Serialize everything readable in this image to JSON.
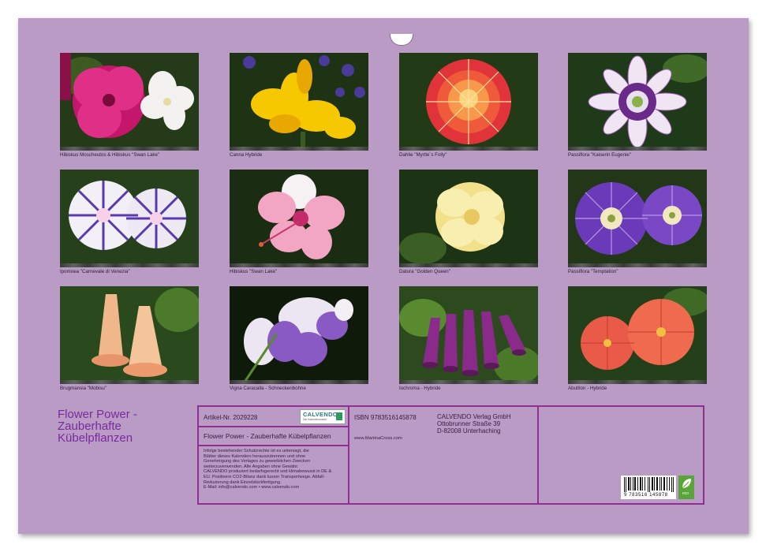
{
  "photos": [
    {
      "caption": "Hibiskus Moscheutos & Hibiskus \"Swan Lake\""
    },
    {
      "caption": "Canna Hybride"
    },
    {
      "caption": "Dahlie \"Myrtle´s Folly\""
    },
    {
      "caption": "Passiflora \"Kaiserin Eugenie\""
    },
    {
      "caption": "Ipomoea \"Carnevale di Venezia\""
    },
    {
      "caption": "Hibiskus \"Swan Lake\""
    },
    {
      "caption": "Datura \"Golden Queen\""
    },
    {
      "caption": "Passiflora \"Temptation\""
    },
    {
      "caption": "Brugmansia \"Mobisu\""
    },
    {
      "caption": "Vigna Caracalla - Schneckenbohne"
    },
    {
      "caption": "Iochroma - Hybride"
    },
    {
      "caption": "Abutilon - Hybride"
    }
  ],
  "title": {
    "line1": "Flower Power -",
    "line2": "Zauberhafte",
    "line3": "Kübelpflanzen"
  },
  "info": {
    "article": "Artikel-Nr. 2029228",
    "logo_name": "CALVENDO",
    "logo_tag": "Die Kalendermarke",
    "product_title": "Flower Power - Zauberhafte Kübelpflanzen",
    "copyright": [
      "Infolge bestehender Schutzrechte ist es untersagt, die",
      "Blätter dieses Kalenders herauszutrennen und ohne",
      "Genehmigung des Verlages zu gewerblichen Zwecken",
      "weiterzuverwenden. Alle Angaben ohne Gewähr.",
      "CALVENDO produziert bedarfsgerecht und klimabewusst in DE &",
      "EU. Positivere CO2-Bilanz dank kurzer Transportwege. Abfall-",
      "Reduzierung dank Einzelstückfertigung.",
      "E-Mail: info@calvendo.com • www.calvendo.com"
    ],
    "isbn": "ISBN 9783516145878",
    "website": "www.MartinaCross.com",
    "publisher": [
      "CALVENDO Verlag GmbH",
      "Ottobrunner Straße 39",
      "D-82008 Unterhaching"
    ],
    "barcode_number": "9 783516 145878",
    "eco_label": "eco"
  }
}
